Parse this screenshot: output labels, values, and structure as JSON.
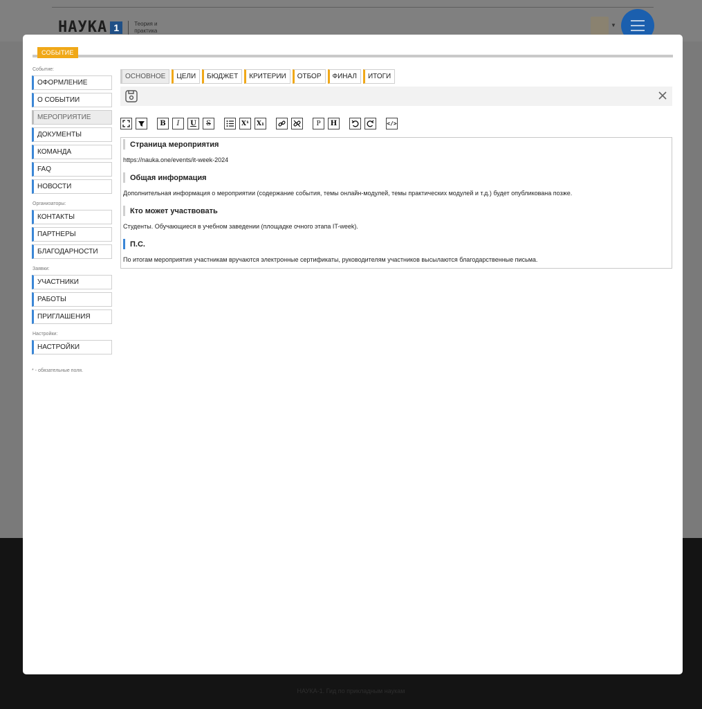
{
  "site": {
    "logo_text": "НАУКА",
    "logo_number": "1",
    "logo_tagline": "Теория и практика",
    "footer_text": "НАУКА-1. Гид по прикладным наукам"
  },
  "modal": {
    "section_tag": "СОБЫТИЕ",
    "sidebar": {
      "groups": [
        {
          "label": "Событие:",
          "items": [
            "ОФОРМЛЕНИЕ",
            "О СОБЫТИИ",
            "МЕРОПРИЯТИЕ",
            "ДОКУМЕНТЫ",
            "КОМАНДА",
            "FAQ",
            "НОВОСТИ"
          ]
        },
        {
          "label": "Организаторы:",
          "items": [
            "КОНТАКТЫ",
            "ПАРТНЕРЫ",
            "БЛАГОДАРНОСТИ"
          ]
        },
        {
          "label": "Заявки:",
          "items": [
            "УЧАСТНИКИ",
            "РАБОТЫ",
            "ПРИГЛАШЕНИЯ"
          ]
        },
        {
          "label": "Настройки:",
          "items": [
            "НАСТРОЙКИ"
          ]
        }
      ],
      "active_item": "МЕРОПРИЯТИЕ",
      "note": "* - обязательные поля."
    },
    "tabs": [
      "ОСНОВНОЕ",
      "ЦЕЛИ",
      "БЮДЖЕТ",
      "КРИТЕРИИ",
      "ОТБОР",
      "ФИНАЛ",
      "ИТОГИ"
    ],
    "active_tab": "ОСНОВНОЕ",
    "toolbar": {
      "bold": "B",
      "italic": "I",
      "underline": "U",
      "strike": "S",
      "superscript": "X¹",
      "subscript": "X₁",
      "paragraph": "P",
      "heading": "H",
      "code": "</>"
    },
    "editor": {
      "heading1": "Страница мероприятия",
      "para1": "https://nauka.one/events/it-week-2024",
      "heading2": "Общая информация",
      "para2": "Дополнительная информация о мероприятии (содержание события, темы онлайн-модулей, темы практических модулей и т.д.) будет опубликована позже.",
      "heading3": "Кто может участвовать",
      "para3": "Студенты. Обучающиеся в учебном заведении (площадке очного этапа IT-week).",
      "heading4": "П.С.",
      "para4": "По итогам мероприятия участникам вручаются электронные сертификаты, руководителям участников высылаются благодарственные письма."
    }
  },
  "colors": {
    "accent_orange": "#f0a818",
    "accent_blue": "#3a86d6",
    "menu_button": "#1b5fae"
  }
}
